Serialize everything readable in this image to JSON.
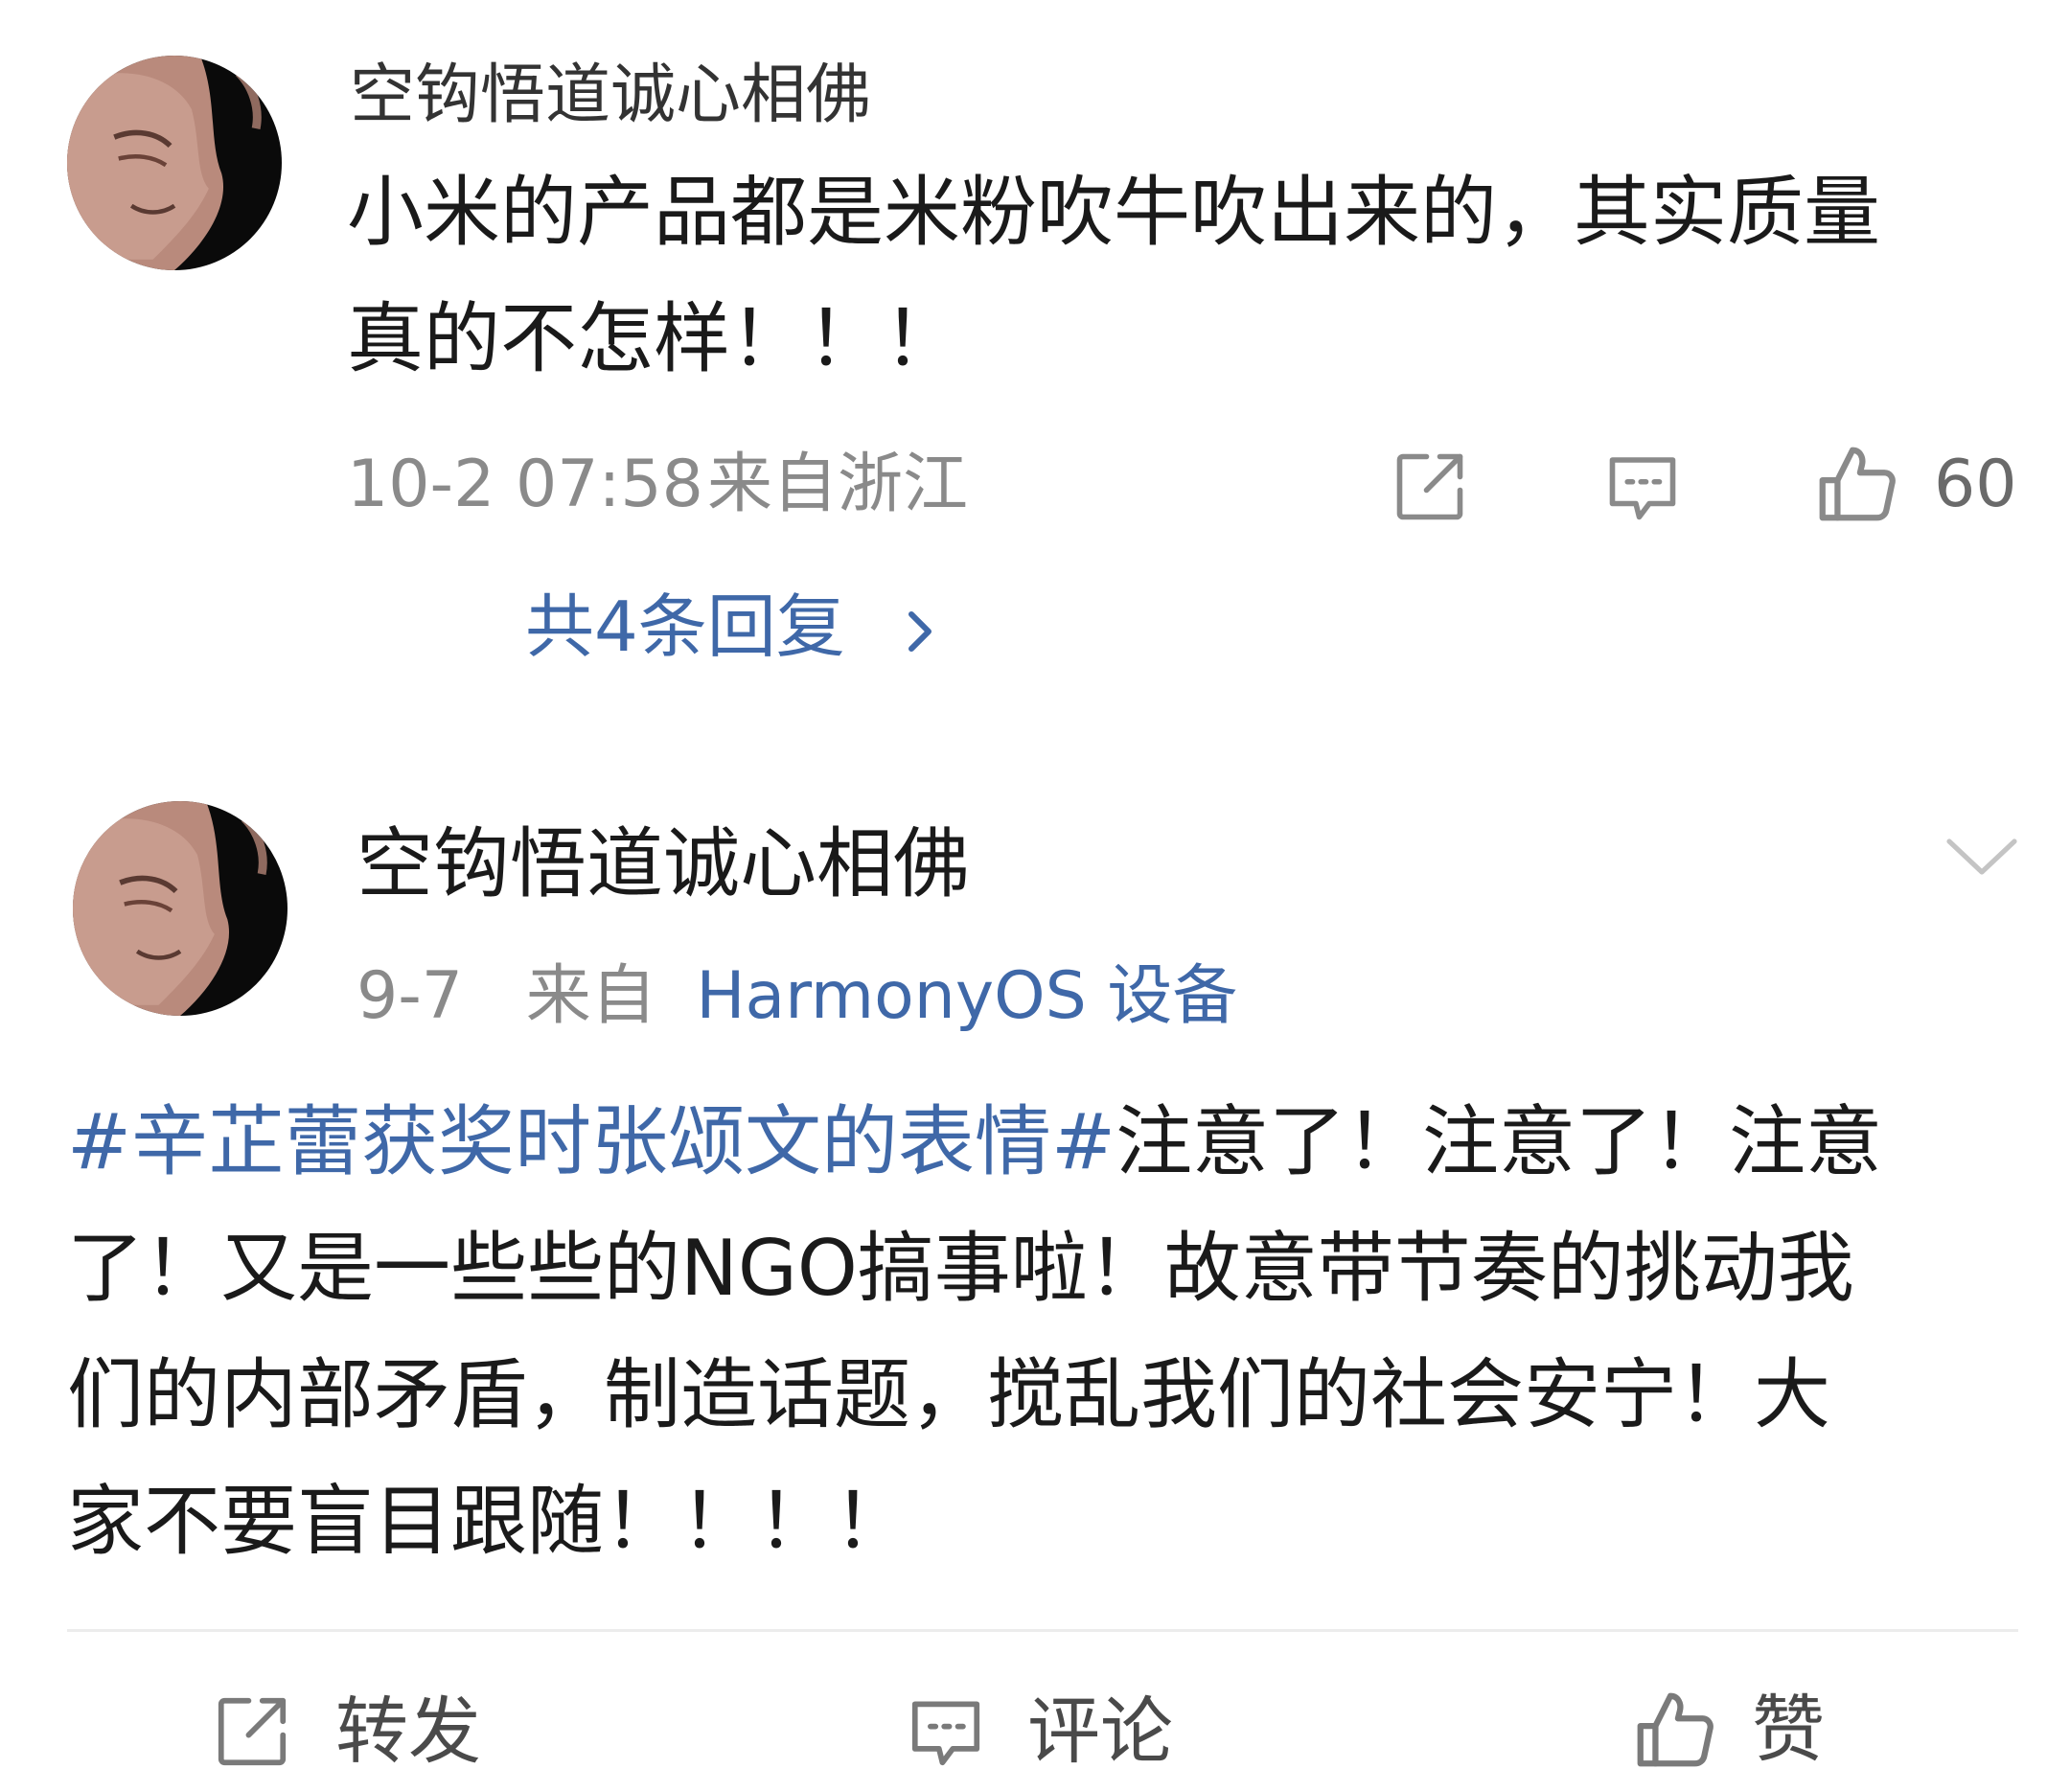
{
  "comment": {
    "username": "空钩悟道诚心相佛",
    "text_line1": "小米的产品都是米粉吹牛吹出来的，其实质量",
    "text_line2": "真的不怎样！！！",
    "time": "10-2 07:58",
    "location": "来自浙江",
    "like_count": "60",
    "replies_link": "共4条回复",
    "icons": [
      "share-icon",
      "comment-icon",
      "like-icon"
    ]
  },
  "post": {
    "username": "空钩悟道诚心相佛",
    "date": "9-7",
    "source_prefix": "来自",
    "source_device": "HarmonyOS 设备",
    "hashtag": "#辛芷蕾获奖时张颂文的表情#",
    "line1_rest": "注意了！注意了！注意",
    "line2": "了！又是一些些的NGO搞事啦！故意带节奏的挑动我",
    "line3": "们的内部矛盾，制造话题，搅乱我们的社会安宁！大",
    "line4": "家不要盲目跟随！！！！"
  },
  "action_bar": {
    "repost_label": "转发",
    "comment_label": "评论",
    "like_label": "赞"
  },
  "colors": {
    "link": "#3f68a8",
    "text": "#1a1a1a",
    "meta": "#8a8a8a",
    "icon": "#888888"
  }
}
